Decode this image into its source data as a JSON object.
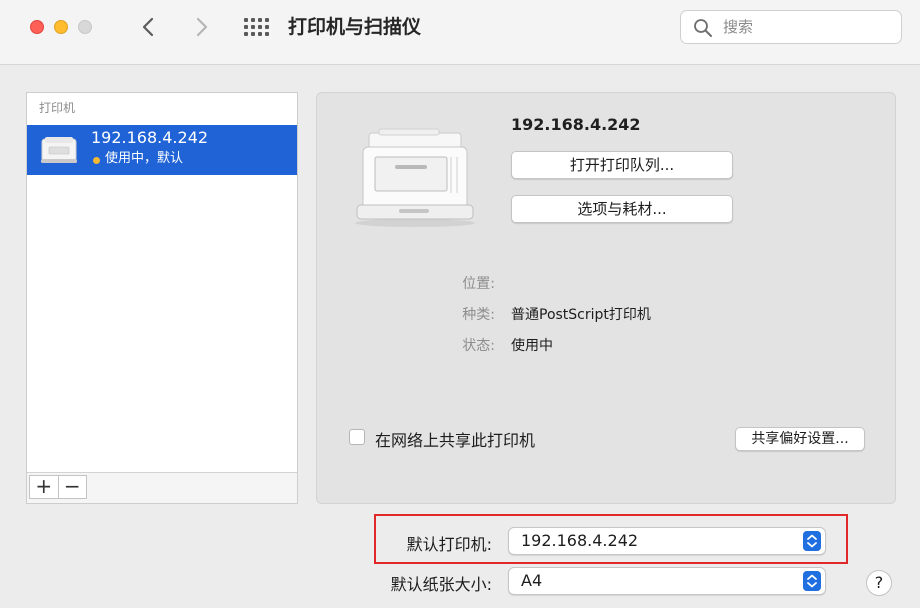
{
  "window": {
    "title": "打印机与扫描仪",
    "search_placeholder": "搜索"
  },
  "sidebar": {
    "header": "打印机",
    "items": [
      {
        "name": "192.168.4.242",
        "status": "使用中，默认",
        "status_color": "#f5b933"
      }
    ],
    "add_label": "+",
    "remove_label": "−"
  },
  "detail": {
    "printer_name": "192.168.4.242",
    "open_queue_label": "打开打印队列...",
    "options_label": "选项与耗材...",
    "info": {
      "location_label": "位置:",
      "location_value": "",
      "kind_label": "种类:",
      "kind_value": "普通PostScript打印机",
      "status_label": "状态:",
      "status_value": "使用中"
    },
    "share_label": "在网络上共享此打印机",
    "share_checked": false,
    "share_prefs_label": "共享偏好设置..."
  },
  "defaults": {
    "default_printer_label": "默认打印机:",
    "default_printer_value": "192.168.4.242",
    "paper_size_label": "默认纸张大小:",
    "paper_size_value": "A4"
  },
  "help_label": "?",
  "colors": {
    "selection": "#1f63d6",
    "highlight_box": "#e0282b",
    "popup_accent": "#1f6fe0"
  }
}
